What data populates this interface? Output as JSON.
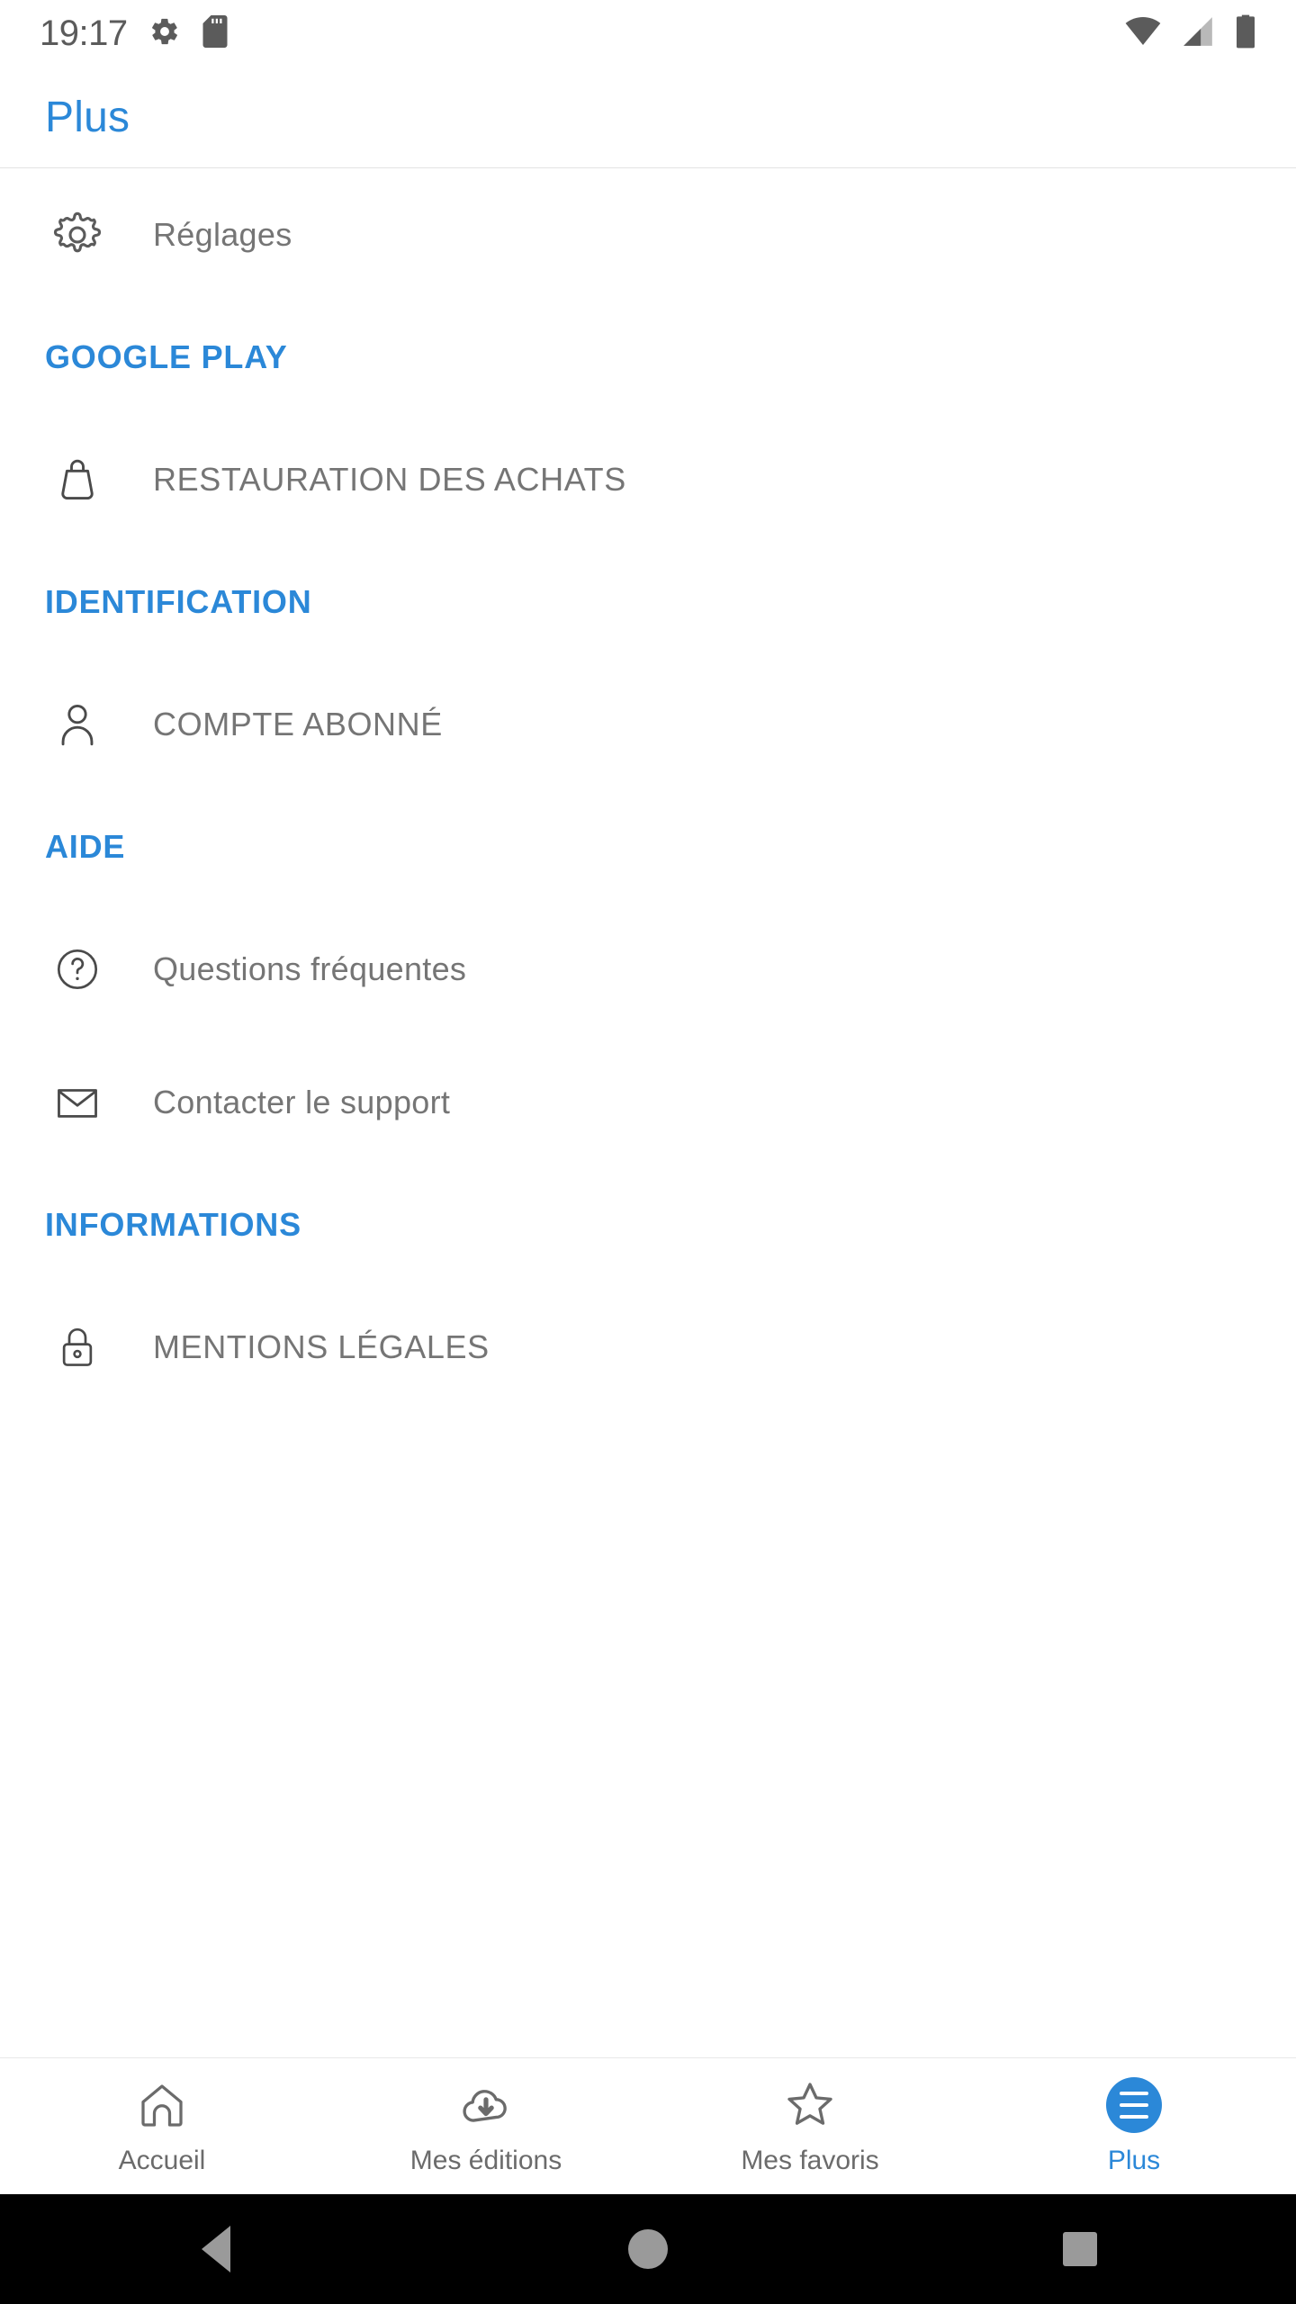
{
  "status_bar": {
    "time": "19:17",
    "left_icons": [
      "gear-icon",
      "sd-card-icon"
    ],
    "right_icons": [
      "wifi-icon",
      "cellular-signal-icon",
      "battery-icon"
    ]
  },
  "app_bar": {
    "title": "Plus"
  },
  "colors": {
    "accent": "#2b88d8",
    "label": "#757575",
    "icon": "#5b5b5b",
    "divider": "#e3e3e3"
  },
  "list": [
    {
      "type": "row",
      "icon": "gear-icon",
      "label": "Réglages",
      "uppercase": false
    },
    {
      "type": "section",
      "label": "GOOGLE PLAY"
    },
    {
      "type": "row",
      "icon": "shopping-bag-icon",
      "label": "RESTAURATION DES ACHATS",
      "uppercase": true
    },
    {
      "type": "section",
      "label": "IDENTIFICATION"
    },
    {
      "type": "row",
      "icon": "person-icon",
      "label": "COMPTE ABONNÉ",
      "uppercase": true
    },
    {
      "type": "section",
      "label": "AIDE"
    },
    {
      "type": "row",
      "icon": "help-circle-icon",
      "label": "Questions fréquentes",
      "uppercase": false
    },
    {
      "type": "row",
      "icon": "envelope-icon",
      "label": "Contacter le support",
      "uppercase": false
    },
    {
      "type": "section",
      "label": "INFORMATIONS"
    },
    {
      "type": "row",
      "icon": "lock-icon",
      "label": "MENTIONS LÉGALES",
      "uppercase": true
    }
  ],
  "tab_bar": {
    "tabs": [
      {
        "label": "Accueil",
        "icon": "home-icon",
        "active": false
      },
      {
        "label": "Mes éditions",
        "icon": "cloud-download-icon",
        "active": false
      },
      {
        "label": "Mes favoris",
        "icon": "star-icon",
        "active": false
      },
      {
        "label": "Plus",
        "icon": "hamburger-menu-icon",
        "active": true
      }
    ]
  },
  "nav_bar": {
    "buttons": [
      "back-button",
      "home-button",
      "recents-button"
    ]
  }
}
